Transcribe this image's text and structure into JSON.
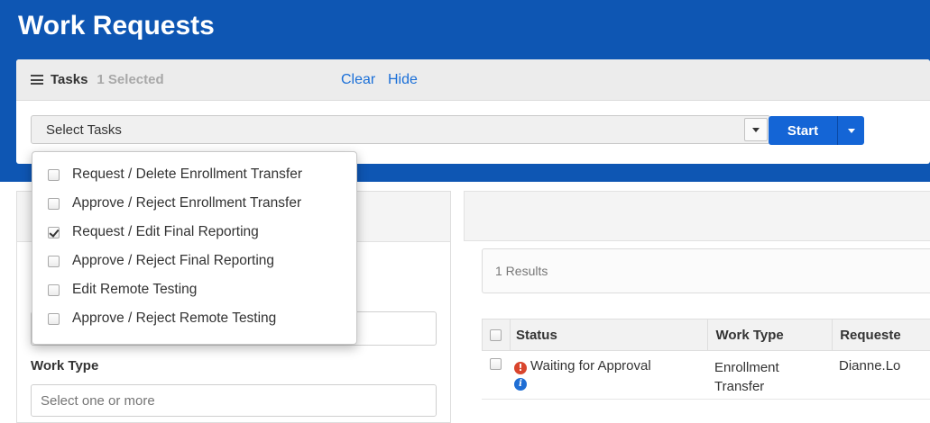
{
  "header": {
    "title": "Work Requests"
  },
  "tasks": {
    "title": "Tasks",
    "selected": "1 Selected",
    "select_placeholder": "Select Tasks",
    "start_label": "Start",
    "options": [
      {
        "label": "Request / Delete Enrollment Transfer",
        "checked": false
      },
      {
        "label": "Approve / Reject Enrollment Transfer",
        "checked": false
      },
      {
        "label": "Request / Edit Final Reporting",
        "checked": true
      },
      {
        "label": "Approve / Reject Final Reporting",
        "checked": false
      },
      {
        "label": "Edit Remote Testing",
        "checked": false
      },
      {
        "label": "Approve / Reject Remote Testing",
        "checked": false
      }
    ]
  },
  "filters": {
    "clear_label": "Clear",
    "hide_label": "Hide",
    "work_type_label": "Work Type",
    "work_type_placeholder": "Select one or more"
  },
  "results": {
    "count_text": "1 Results",
    "columns": [
      "Status",
      "Work Type",
      "Requeste"
    ],
    "rows": [
      {
        "status": "Waiting for Approval",
        "work_type_line1": "Enrollment",
        "work_type_line2": "Transfer",
        "requester": "Dianne.Lo"
      }
    ]
  },
  "colors": {
    "brand_blue": "#0e56b3",
    "primary_button": "#1465d6",
    "link": "#1a6fd8",
    "alert": "#d9452d"
  }
}
